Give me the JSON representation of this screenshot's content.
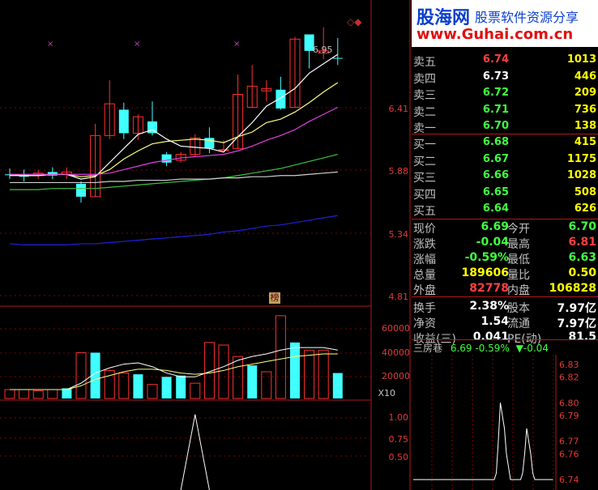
{
  "chart_data": [
    {
      "type": "candlestick",
      "price_ticks": [
        "6.41",
        "5.88",
        "5.34",
        "4.81"
      ],
      "ylim": [
        4.6,
        7.1
      ],
      "max_label": "6.95",
      "flag_label": "榜",
      "candles": [
        {
          "o": 5.7,
          "c": 5.7,
          "h": 5.75,
          "l": 5.66,
          "up": false
        },
        {
          "o": 5.7,
          "c": 5.68,
          "h": 5.74,
          "l": 5.64,
          "up": false
        },
        {
          "o": 5.69,
          "c": 5.71,
          "h": 5.74,
          "l": 5.66,
          "up": true
        },
        {
          "o": 5.72,
          "c": 5.69,
          "h": 5.76,
          "l": 5.66,
          "up": false
        },
        {
          "o": 5.7,
          "c": 5.72,
          "h": 5.76,
          "l": 5.66,
          "up": true
        },
        {
          "o": 5.62,
          "c": 5.51,
          "h": 5.64,
          "l": 5.46,
          "up": false
        },
        {
          "o": 5.51,
          "c": 6.03,
          "h": 6.13,
          "l": 5.51,
          "up": true
        },
        {
          "o": 6.03,
          "c": 6.3,
          "h": 6.5,
          "l": 6.0,
          "up": true
        },
        {
          "o": 6.25,
          "c": 6.05,
          "h": 6.31,
          "l": 6.0,
          "up": false
        },
        {
          "o": 6.05,
          "c": 6.19,
          "h": 6.21,
          "l": 5.99,
          "up": true
        },
        {
          "o": 6.15,
          "c": 6.05,
          "h": 6.32,
          "l": 6.03,
          "up": false
        },
        {
          "o": 5.87,
          "c": 5.8,
          "h": 5.89,
          "l": 5.77,
          "up": false
        },
        {
          "o": 5.82,
          "c": 5.87,
          "h": 5.89,
          "l": 5.8,
          "up": true
        },
        {
          "o": 5.87,
          "c": 6.01,
          "h": 6.04,
          "l": 5.85,
          "up": true
        },
        {
          "o": 6.01,
          "c": 5.92,
          "h": 6.1,
          "l": 5.88,
          "up": false
        },
        {
          "o": 5.91,
          "c": 5.91,
          "h": 5.99,
          "l": 5.9,
          "up": true
        },
        {
          "o": 5.92,
          "c": 6.38,
          "h": 6.55,
          "l": 5.92,
          "up": true
        },
        {
          "o": 6.27,
          "c": 6.45,
          "h": 6.63,
          "l": 6.27,
          "up": true
        },
        {
          "o": 6.41,
          "c": 6.43,
          "h": 6.5,
          "l": 6.32,
          "up": true
        },
        {
          "o": 6.42,
          "c": 6.26,
          "h": 6.53,
          "l": 6.25,
          "up": false
        },
        {
          "o": 6.27,
          "c": 6.85,
          "h": 6.87,
          "l": 6.27,
          "up": true
        },
        {
          "o": 6.75,
          "c": 6.89,
          "h": 6.89,
          "l": 6.6,
          "up": false
        },
        {
          "o": 6.73,
          "c": 6.75,
          "h": 6.95,
          "l": 6.68,
          "up": true
        },
        {
          "o": 6.69,
          "c": 6.69,
          "h": 6.86,
          "l": 6.63,
          "up": false
        }
      ],
      "ma_lines": [
        {
          "color": "#ffffff",
          "values": [
            5.69,
            5.69,
            5.69,
            5.7,
            5.7,
            5.66,
            5.68,
            5.8,
            5.92,
            6.04,
            6.08,
            6.0,
            5.94,
            5.93,
            5.92,
            5.89,
            6.02,
            6.14,
            6.28,
            6.35,
            6.43,
            6.56,
            6.64,
            6.72
          ]
        },
        {
          "color": "#ffff80",
          "values": [
            5.7,
            5.69,
            5.69,
            5.7,
            5.7,
            5.68,
            5.69,
            5.74,
            5.83,
            5.9,
            5.96,
            5.98,
            5.99,
            6.0,
            5.99,
            5.97,
            6.02,
            6.06,
            6.14,
            6.17,
            6.23,
            6.31,
            6.4,
            6.48
          ]
        },
        {
          "color": "#e040e0",
          "values": [
            5.7,
            5.7,
            5.7,
            5.7,
            5.7,
            5.7,
            5.7,
            5.71,
            5.74,
            5.77,
            5.8,
            5.82,
            5.84,
            5.85,
            5.86,
            5.87,
            5.9,
            5.94,
            5.99,
            6.03,
            6.08,
            6.15,
            6.21,
            6.27
          ]
        },
        {
          "color": "#40c040",
          "values": [
            5.57,
            5.57,
            5.57,
            5.58,
            5.58,
            5.58,
            5.58,
            5.59,
            5.6,
            5.61,
            5.62,
            5.63,
            5.64,
            5.65,
            5.66,
            5.67,
            5.69,
            5.71,
            5.73,
            5.75,
            5.78,
            5.81,
            5.84,
            5.87
          ]
        },
        {
          "color": "#d0d0d0",
          "values": [
            5.63,
            5.63,
            5.63,
            5.63,
            5.63,
            5.63,
            5.63,
            5.64,
            5.64,
            5.65,
            5.65,
            5.65,
            5.66,
            5.66,
            5.66,
            5.67,
            5.67,
            5.68,
            5.68,
            5.69,
            5.69,
            5.7,
            5.71,
            5.72
          ]
        },
        {
          "color": "#2020e0",
          "values": [
            5.11,
            5.1,
            5.1,
            5.1,
            5.1,
            5.11,
            5.11,
            5.12,
            5.13,
            5.14,
            5.15,
            5.16,
            5.17,
            5.18,
            5.19,
            5.21,
            5.22,
            5.24,
            5.26,
            5.27,
            5.29,
            5.31,
            5.33,
            5.35
          ]
        }
      ]
    },
    {
      "type": "bar",
      "ticks": [
        "60000",
        "40000",
        "20000"
      ],
      "ylim": [
        0,
        70000
      ],
      "unit_label": "X10",
      "values": [
        7000,
        7000,
        6000,
        7000,
        8000,
        36000,
        36000,
        22000,
        20000,
        19000,
        11000,
        17000,
        18000,
        12000,
        44000,
        42000,
        33000,
        26000,
        21000,
        65000,
        44000,
        38000,
        38000,
        20000
      ],
      "up": [
        true,
        true,
        true,
        true,
        false,
        true,
        false,
        true,
        true,
        false,
        true,
        false,
        false,
        true,
        true,
        true,
        true,
        false,
        true,
        true,
        false,
        true,
        true,
        false
      ],
      "ma_lines": [
        {
          "color": "#ffffff",
          "values": [
            7000,
            7000,
            7000,
            7000,
            7000,
            12000,
            20000,
            24000,
            27000,
            28000,
            25000,
            20000,
            17000,
            17000,
            21000,
            25000,
            30000,
            33000,
            35000,
            38000,
            40000,
            40000,
            40000,
            38000
          ]
        },
        {
          "color": "#ffff80",
          "values": [
            7000,
            7000,
            7000,
            7000,
            7000,
            10000,
            15000,
            18000,
            21000,
            23000,
            23000,
            22000,
            20000,
            19000,
            20000,
            22000,
            25000,
            27000,
            29000,
            31000,
            33000,
            34000,
            35000,
            35000
          ]
        }
      ]
    },
    {
      "type": "line",
      "ticks": [
        "1.00",
        "0.75",
        "0.50"
      ],
      "ylim": [
        0.2,
        1.1
      ],
      "values": [
        0,
        0,
        0,
        0,
        0,
        0,
        0,
        0,
        0,
        0,
        0,
        0,
        0.2,
        1.0,
        0.2,
        0,
        0,
        0,
        0,
        0,
        0,
        0,
        0,
        0
      ]
    },
    {
      "type": "line",
      "ticks": [
        "6.83",
        "6.82",
        "6.80",
        "6.79",
        "6.77",
        "6.76",
        "6.74"
      ],
      "ylim": [
        6.735,
        6.835
      ],
      "values": [
        6.74,
        6.74,
        6.74,
        6.74,
        6.74,
        6.74,
        6.74,
        6.74,
        6.74,
        6.74,
        6.74,
        6.74,
        6.74,
        6.74,
        6.74,
        6.74,
        6.74,
        6.74,
        6.74,
        6.74,
        6.74,
        6.74,
        6.74,
        6.74,
        6.74,
        6.74,
        6.74,
        6.74,
        6.74,
        6.74,
        6.74,
        6.74,
        6.74,
        6.74,
        6.74,
        6.74,
        6.74,
        6.74,
        6.74,
        6.74,
        6.74,
        6.745,
        6.77,
        6.8,
        6.79,
        6.78,
        6.76,
        6.75,
        6.74,
        6.74,
        6.74,
        6.74,
        6.74,
        6.74,
        6.745,
        6.76,
        6.78,
        6.77,
        6.76,
        6.745,
        6.74,
        6.74,
        6.74,
        6.74,
        6.74,
        6.74,
        6.74,
        6.74,
        6.74,
        6.74
      ]
    }
  ],
  "watermark": {
    "title": "股海网",
    "sub": "股票软件资源分享",
    "url": "www.Guhai.com.cn"
  },
  "order_book": [
    {
      "label": "卖五",
      "price": "6.74",
      "vol": "1013",
      "color": "#ff4040"
    },
    {
      "label": "卖四",
      "price": "6.73",
      "vol": "446",
      "color": "#ffffff"
    },
    {
      "label": "卖三",
      "price": "6.72",
      "vol": "209",
      "color": "#40ff40"
    },
    {
      "label": "卖二",
      "price": "6.71",
      "vol": "736",
      "color": "#40ff40"
    },
    {
      "label": "卖一",
      "price": "6.70",
      "vol": "138",
      "color": "#40ff40"
    },
    {
      "label": "买一",
      "price": "6.68",
      "vol": "415",
      "color": "#40ff40"
    },
    {
      "label": "买二",
      "price": "6.67",
      "vol": "1175",
      "color": "#40ff40"
    },
    {
      "label": "买三",
      "price": "6.66",
      "vol": "1028",
      "color": "#40ff40"
    },
    {
      "label": "买四",
      "price": "6.65",
      "vol": "508",
      "color": "#40ff40"
    },
    {
      "label": "买五",
      "price": "6.64",
      "vol": "626",
      "color": "#40ff40"
    }
  ],
  "stats": [
    {
      "l1": "现价",
      "v1": "6.69",
      "c1": "#40ff40",
      "l2": "今开",
      "v2": "6.70",
      "c2": "#40ff40"
    },
    {
      "l1": "涨跌",
      "v1": "-0.04",
      "c1": "#40ff40",
      "l2": "最高",
      "v2": "6.81",
      "c2": "#ff4040"
    },
    {
      "l1": "涨幅",
      "v1": "-0.59%",
      "c1": "#40ff40",
      "l2": "最低",
      "v2": "6.63",
      "c2": "#40ff40"
    },
    {
      "l1": "总量",
      "v1": "189606",
      "c1": "#ffff00",
      "l2": "量比",
      "v2": "0.50",
      "c2": "#ffff00"
    },
    {
      "l1": "外盘",
      "v1": "82778",
      "c1": "#ff4040",
      "l2": "内盘",
      "v2": "106828",
      "c2": "#ffff00"
    },
    {
      "l1": "换手",
      "v1": "2.38%",
      "c1": "#ffffff",
      "l2": "股本",
      "v2": "7.97亿",
      "c2": "#ffffff"
    },
    {
      "l1": "净资",
      "v1": "1.54",
      "c1": "#ffffff",
      "l2": "流通",
      "v2": "7.97亿",
      "c2": "#ffffff"
    },
    {
      "l1": "收益(三)",
      "v1": "0.041",
      "c1": "#ffffff",
      "l2": "PE(动)",
      "v2": "81.5",
      "c2": "#ffffff"
    }
  ],
  "tick_chart": {
    "name": "三房巷",
    "price": "6.69",
    "pct": "-0.59%",
    "arrow": "▼",
    "change": "-0.04"
  },
  "colors": {
    "up": "#ff3030",
    "down": "#40ffff",
    "grid": "#800000",
    "border": "#b01818"
  }
}
